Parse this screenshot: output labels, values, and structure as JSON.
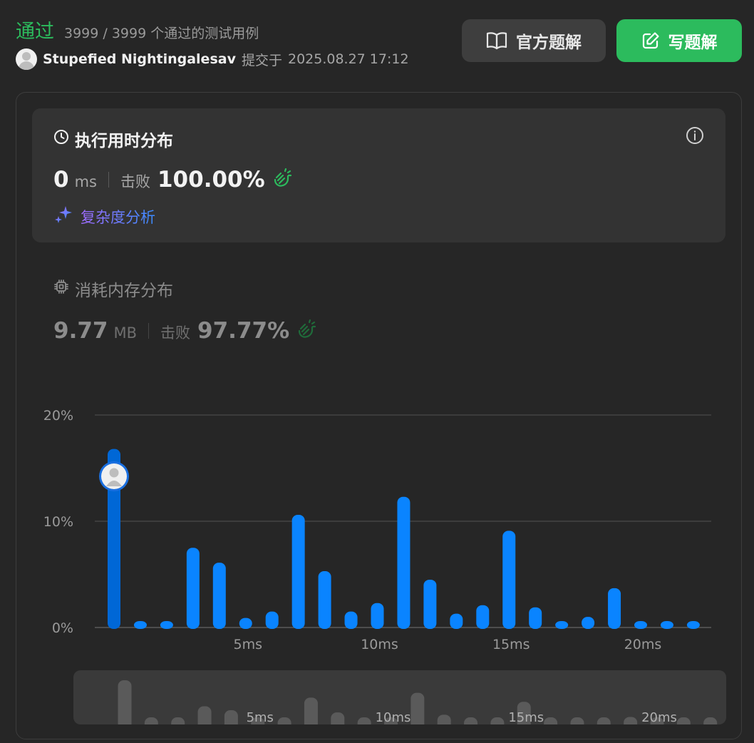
{
  "header": {
    "status": "通过",
    "passed": "3999 / 3999 个通过的测试用例",
    "username": "Stupefied Nightingalesav",
    "submitted_label": "提交于",
    "submitted_time": "2025.08.27 17:12",
    "official_solution_label": "官方题解",
    "write_solution_label": "写题解"
  },
  "runtime": {
    "title": "执行用时分布",
    "value": "0",
    "unit": "ms",
    "beats_label": "击败",
    "beats_value": "100.00%",
    "complexity_label": "复杂度分析"
  },
  "memory": {
    "title": "消耗内存分布",
    "value": "9.77",
    "unit": "MB",
    "beats_label": "击败",
    "beats_value": "97.77%"
  },
  "colors": {
    "accent_green": "#2cbb5d",
    "bar_blue": "#0a84ff",
    "highlight_blue": "#0067d6"
  },
  "chart_data": {
    "type": "bar",
    "title": "",
    "xlabel": "",
    "ylabel": "",
    "x_tick_labels": [
      "5ms",
      "10ms",
      "15ms",
      "20ms"
    ],
    "y_tick_labels": [
      "20%",
      "10%",
      "0%"
    ],
    "ylim": [
      0,
      20
    ],
    "categories": [
      0,
      1,
      2,
      3,
      4,
      5,
      6,
      7,
      8,
      9,
      10,
      11,
      12,
      13,
      14,
      15,
      16,
      17,
      18,
      19,
      20,
      21,
      22
    ],
    "values": [
      16.8,
      0.6,
      0.6,
      7.5,
      6.1,
      0.9,
      1.5,
      10.6,
      5.3,
      1.5,
      2.3,
      12.3,
      4.5,
      1.3,
      2.1,
      9.1,
      1.9,
      0.6,
      1.0,
      3.7,
      0.6,
      0.6,
      0.6
    ],
    "highlighted_category": 0,
    "grid": true
  }
}
